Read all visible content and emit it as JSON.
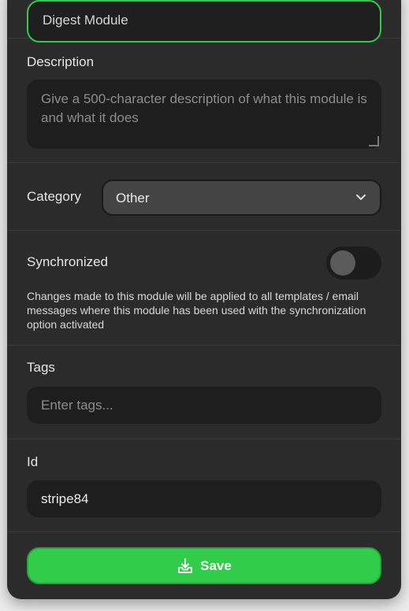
{
  "name_field": {
    "value": "Digest Module"
  },
  "description": {
    "label": "Description",
    "placeholder": "Give a 500-character description of what this module is and what it does"
  },
  "category": {
    "label": "Category",
    "selected": "Other"
  },
  "synchronized": {
    "label": "Synchronized",
    "enabled": false,
    "hint": "Changes made to this module will be applied to all templates / email messages where this module has been used with the synchronization option activated"
  },
  "tags": {
    "label": "Tags",
    "placeholder": "Enter tags..."
  },
  "id_field": {
    "label": "Id",
    "value": "stripe84"
  },
  "save": {
    "label": "Save"
  },
  "colors": {
    "accent": "#30cc4a",
    "panel": "#2b2b2b",
    "field": "#1e1e1e"
  }
}
